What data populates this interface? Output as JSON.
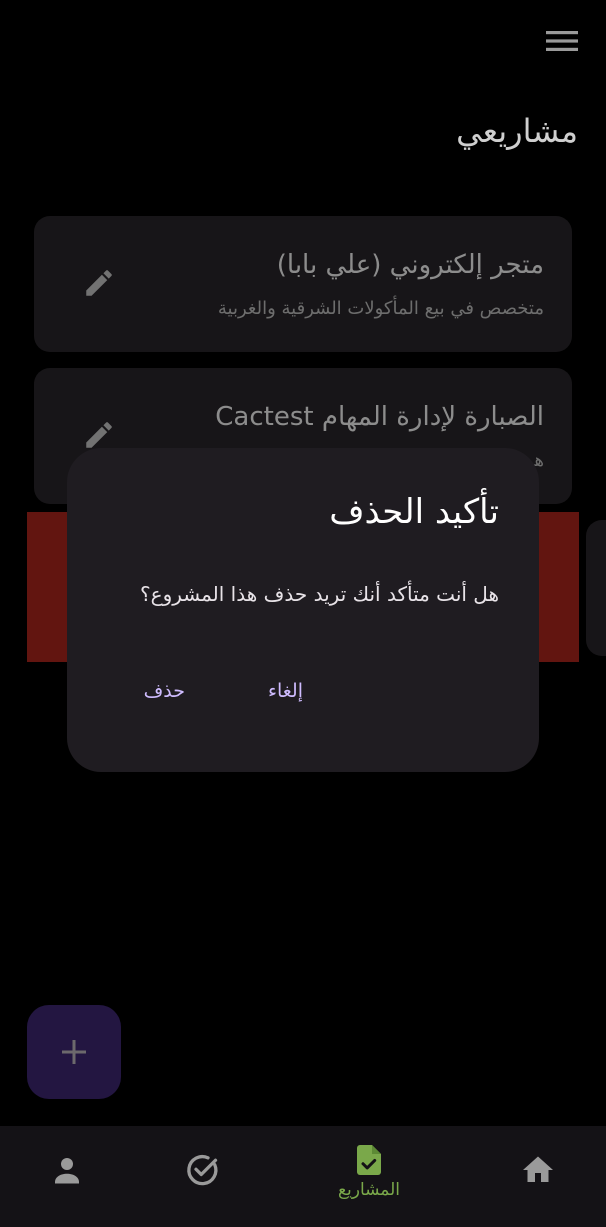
{
  "header": {
    "title": "مشاريعي",
    "menu_icon": "menu-icon"
  },
  "projects": [
    {
      "title": "متجر إلكتروني (علي بابا)",
      "subtitle": "متخصص في بيع المأكولات الشرقية والغربية",
      "edit_icon": "edit-icon"
    },
    {
      "title": "الصبارة لإدارة المهام Cactest",
      "subtitle": "هـ",
      "edit_icon": "edit-icon"
    }
  ],
  "dialog": {
    "title": "تأكيد الحذف",
    "message": "هل أنت متأكد أنك تريد حذف هذا المشروع؟",
    "cancel_label": "إلغاء",
    "delete_label": "حذف"
  },
  "fab": {
    "icon": "plus-icon"
  },
  "bottom_nav": {
    "items": [
      {
        "icon": "person-icon",
        "label": ""
      },
      {
        "icon": "check-circle-icon",
        "label": ""
      },
      {
        "icon": "document-check-icon",
        "label": "المشاريع",
        "active": true
      },
      {
        "icon": "home-icon",
        "label": ""
      }
    ]
  },
  "colors": {
    "background": "#000000",
    "card": "#2a272b",
    "dialog": "#1f1c21",
    "delete_swipe": "#b3261e",
    "accent_purple": "#cfbcff",
    "fab": "#4a2f8c",
    "nav_active": "#7aa84a"
  }
}
